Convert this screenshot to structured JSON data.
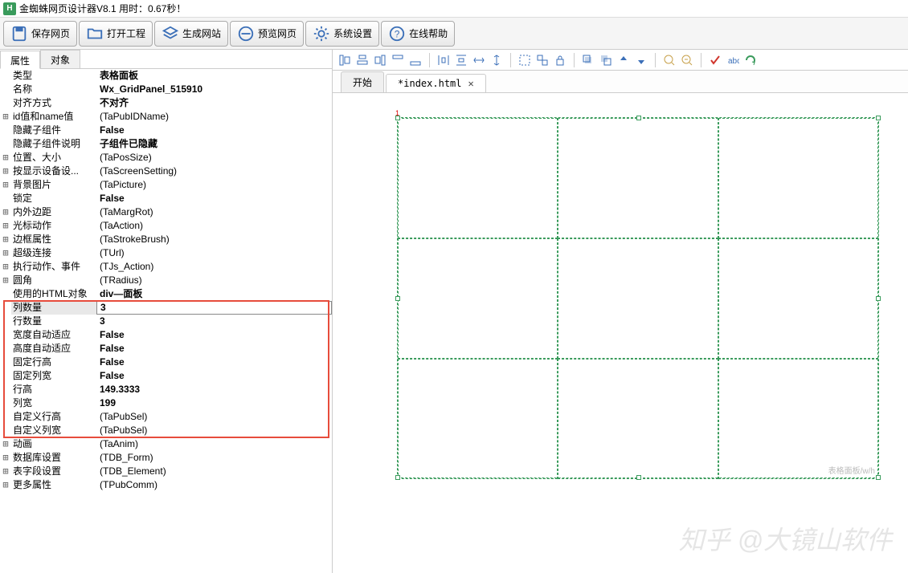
{
  "title": "金蜘蛛网页设计器V8.1  用时：0.67秒！",
  "toolbar": {
    "save": "保存网页",
    "open": "打开工程",
    "gen": "生成网站",
    "preview": "预览网页",
    "settings": "系统设置",
    "help": "在线帮助"
  },
  "left_tabs": {
    "attr": "属性",
    "obj": "对象"
  },
  "props": [
    {
      "exp": "",
      "label": "类型",
      "value": "表格面板",
      "bold": true
    },
    {
      "exp": "",
      "label": "名称",
      "value": "Wx_GridPanel_515910",
      "bold": true
    },
    {
      "exp": "",
      "label": "对齐方式",
      "value": "不对齐",
      "bold": true
    },
    {
      "exp": "+",
      "label": "id值和name值",
      "value": "(TaPubIDName)"
    },
    {
      "exp": "",
      "label": "隐藏子组件",
      "value": "False",
      "bold": true
    },
    {
      "exp": "",
      "label": "隐藏子组件说明",
      "value": "子组件已隐藏",
      "bold": true
    },
    {
      "exp": "+",
      "label": "位置、大小",
      "value": "(TaPosSize)"
    },
    {
      "exp": "+",
      "label": "按显示设备设...",
      "value": "(TaScreenSetting)"
    },
    {
      "exp": "+",
      "label": "背景图片",
      "value": "(TaPicture)"
    },
    {
      "exp": "",
      "label": "锁定",
      "value": "False",
      "bold": true
    },
    {
      "exp": "+",
      "label": "内外边距",
      "value": "(TaMargRot)"
    },
    {
      "exp": "+",
      "label": "光标动作",
      "value": "(TaAction)"
    },
    {
      "exp": "+",
      "label": "边框属性",
      "value": "(TaStrokeBrush)"
    },
    {
      "exp": "+",
      "label": "超级连接",
      "value": "(TUrl)"
    },
    {
      "exp": "+",
      "label": "执行动作、事件",
      "value": "(TJs_Action)"
    },
    {
      "exp": "+",
      "label": "圆角",
      "value": "(TRadius)"
    },
    {
      "exp": "",
      "label": "使用的HTML对象",
      "value": "div—面板",
      "bold": true
    },
    {
      "exp": "",
      "label": "列数量",
      "value": "3",
      "bold": true,
      "selected": true
    },
    {
      "exp": "",
      "label": "行数量",
      "value": "3",
      "bold": true
    },
    {
      "exp": "",
      "label": "宽度自动适应",
      "value": "False",
      "bold": true
    },
    {
      "exp": "",
      "label": "高度自动适应",
      "value": "False",
      "bold": true
    },
    {
      "exp": "",
      "label": "固定行高",
      "value": "False",
      "bold": true
    },
    {
      "exp": "",
      "label": "固定列宽",
      "value": "False",
      "bold": true
    },
    {
      "exp": "",
      "label": "行高",
      "value": "149.3333",
      "bold": true
    },
    {
      "exp": "",
      "label": "列宽",
      "value": "199",
      "bold": true
    },
    {
      "exp": "",
      "label": "自定义行高",
      "value": "(TaPubSel)"
    },
    {
      "exp": "",
      "label": "自定义列宽",
      "value": "(TaPubSel)"
    },
    {
      "exp": "+",
      "label": "动画",
      "value": "(TaAnim)"
    },
    {
      "exp": "+",
      "label": "数据库设置",
      "value": "(TDB_Form)"
    },
    {
      "exp": "+",
      "label": "表字段设置",
      "value": "(TDB_Element)"
    },
    {
      "exp": "+",
      "label": "更多属性",
      "value": "(TPubComm)"
    }
  ],
  "doc_tabs": {
    "start": "开始",
    "file": "*index.html"
  },
  "canvas_label": "表格面板/w/h",
  "ruler_num": "1",
  "watermark": "知乎 @大镜山软件"
}
